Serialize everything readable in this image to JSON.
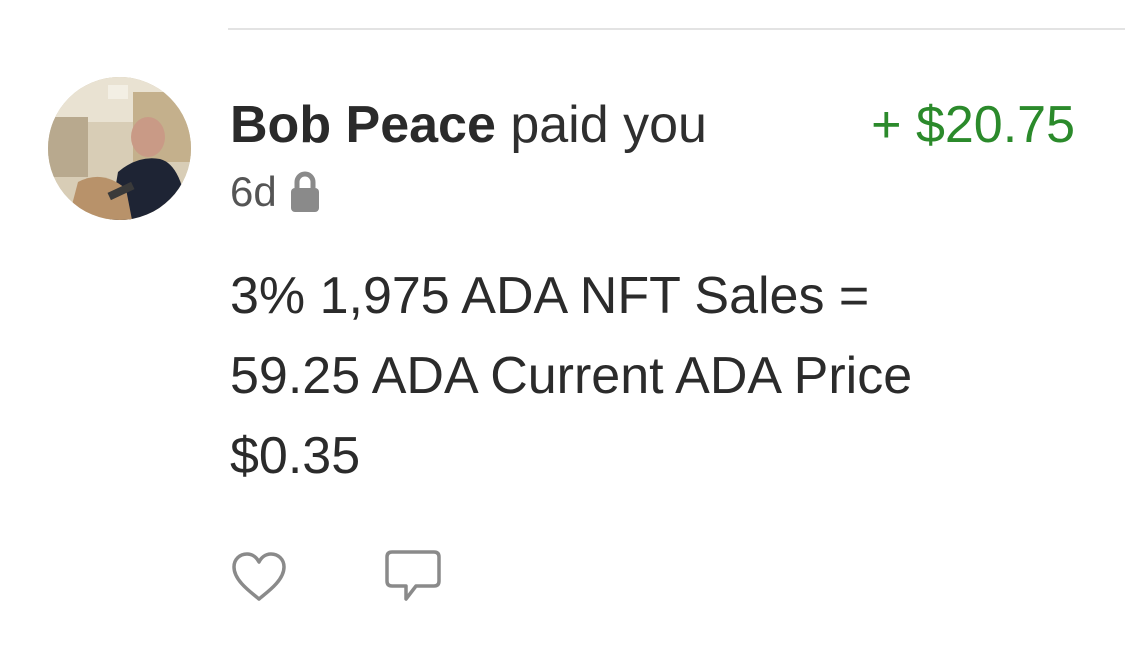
{
  "story": {
    "actor_name": "Bob Peace",
    "action_text": "paid you",
    "amount": "+ $20.75",
    "time_ago": "6d",
    "privacy_icon": "lock-icon",
    "note_lines": [
      "3% 1,975 ADA NFT Sales =",
      "59.25 ADA Current ADA Price",
      "$0.35"
    ],
    "like_icon": "heart-outline-icon",
    "comment_icon": "speech-bubble-icon"
  },
  "colors": {
    "amount_positive": "#2b8a2b",
    "text_primary": "#2b2b2b",
    "text_secondary": "#555555",
    "icon_gray": "#8a8a8a",
    "divider": "#e3e3e3"
  }
}
